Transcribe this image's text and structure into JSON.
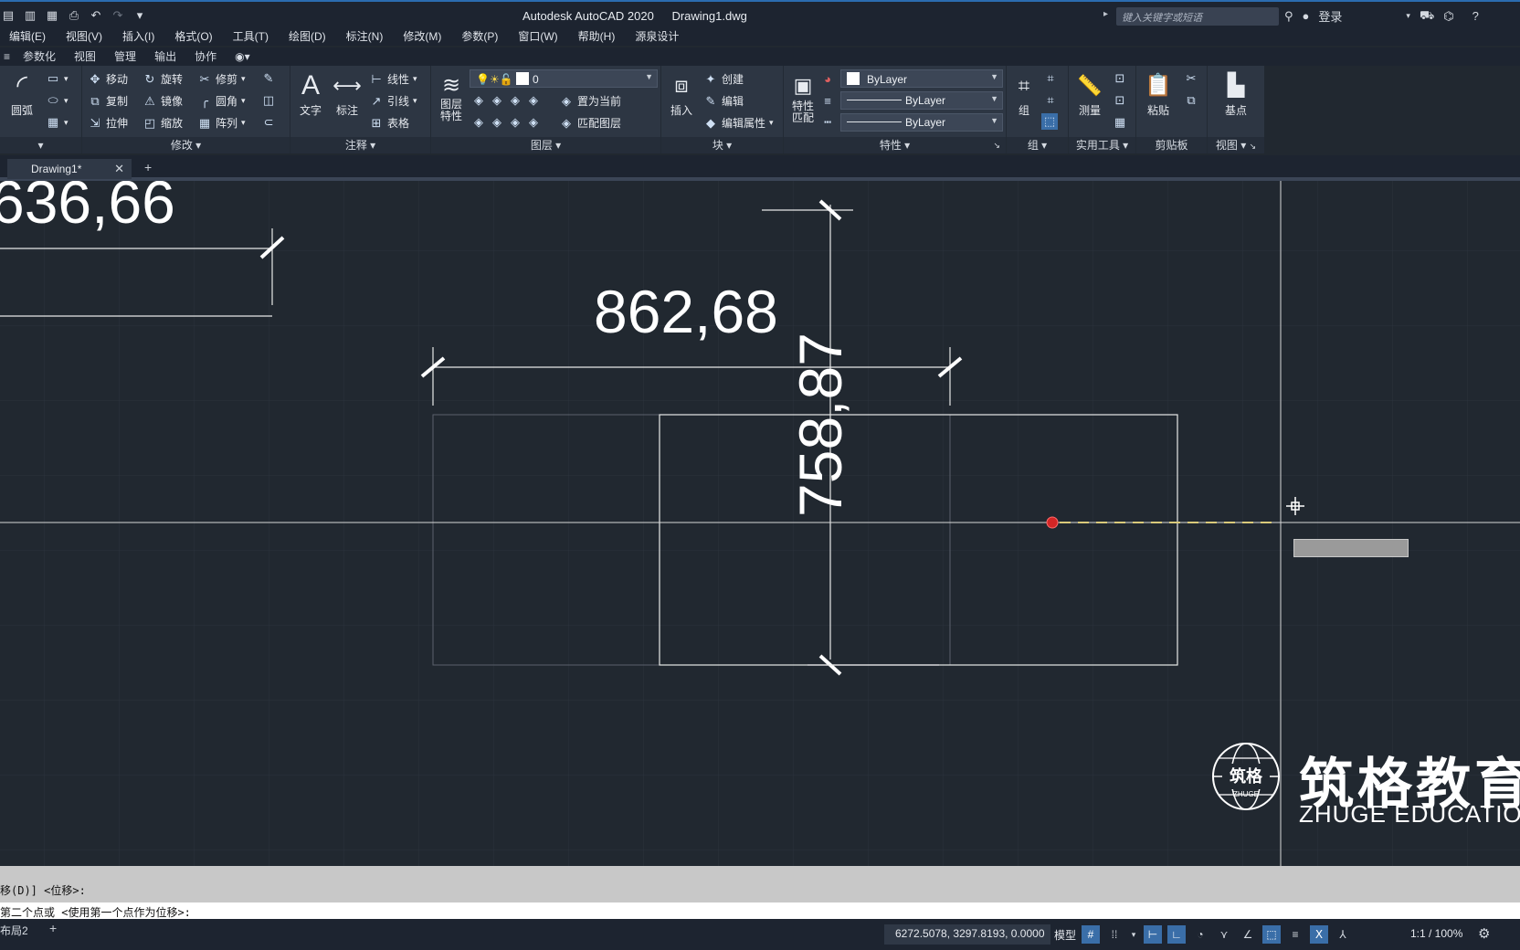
{
  "titlebar": {
    "app_name": "Autodesk AutoCAD 2020",
    "file_name": "Drawing1.dwg",
    "search_placeholder": "键入关键字或短语",
    "login": "登录"
  },
  "menubar": {
    "items": [
      "编辑(E)",
      "视图(V)",
      "插入(I)",
      "格式(O)",
      "工具(T)",
      "绘图(D)",
      "标注(N)",
      "修改(M)",
      "参数(P)",
      "窗口(W)",
      "帮助(H)",
      "源泉设计"
    ]
  },
  "ribbon_tabs": {
    "items": [
      "参数化",
      "视图",
      "管理",
      "输出",
      "协作"
    ]
  },
  "ribbon": {
    "draw": {
      "arc": "圆弧"
    },
    "modify": {
      "title": "修改",
      "move": "移动",
      "rotate": "旋转",
      "trim": "修剪",
      "copy": "复制",
      "mirror": "镜像",
      "fillet": "圆角",
      "stretch": "拉伸",
      "scale": "缩放",
      "array": "阵列"
    },
    "annotation": {
      "title": "注释",
      "text": "文字",
      "dimension": "标注",
      "linear": "线性",
      "leader": "引线",
      "table": "表格"
    },
    "layers": {
      "title": "图层",
      "layer_props": "图层\n特性",
      "current_layer": "0",
      "set_current": "置为当前",
      "match_layer": "匹配图层"
    },
    "block": {
      "title": "块",
      "insert": "插入",
      "create": "创建",
      "edit": "编辑",
      "edit_attr": "编辑属性"
    },
    "properties": {
      "title": "特性",
      "match": "特性\n匹配",
      "color": "ByLayer",
      "linetype": "ByLayer",
      "lineweight": "ByLayer"
    },
    "groups": {
      "title": "组",
      "group": "组"
    },
    "utilities": {
      "title": "实用工具",
      "measure": "测量"
    },
    "clipboard": {
      "title": "剪贴板",
      "paste": "粘贴"
    },
    "view": {
      "title": "视图",
      "base": "基点"
    }
  },
  "filetabs": {
    "active": "Drawing1*"
  },
  "canvas": {
    "dim_top_left": "636,66",
    "dim_horizontal": "862,68",
    "dim_vertical": "758,87",
    "logo_cn": "筑格教育",
    "logo_en": "ZHUGE EDUCATION",
    "logo_badge": "筑格",
    "logo_badge_en": "ZHUGE"
  },
  "command": {
    "history_line": "移(D)] <位移>:",
    "prompt_line": "第二个点或 <使用第一个点作为位移>:"
  },
  "statusbar": {
    "layout_tab": "布局2",
    "coordinates": "6272.5078, 3297.8193, 0.0000",
    "model": "模型",
    "scale": "1:1 / 100%"
  }
}
